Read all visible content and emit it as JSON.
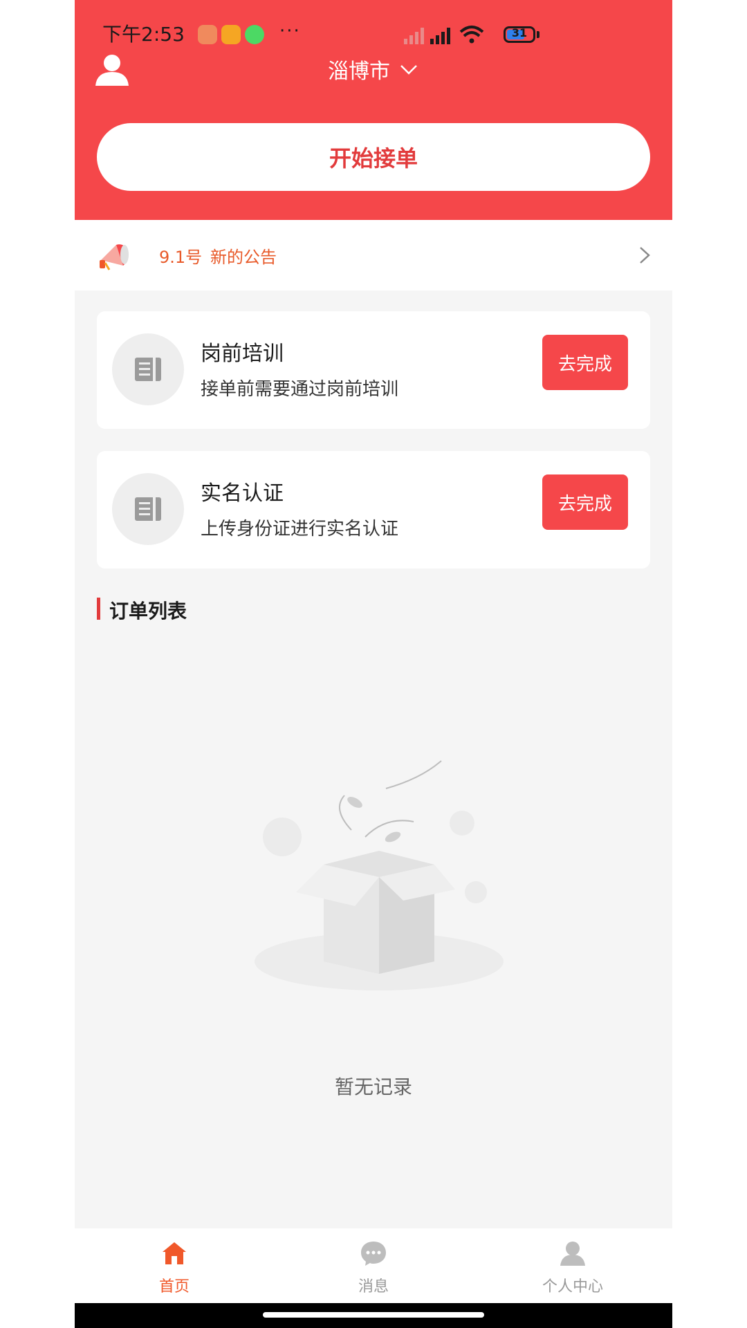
{
  "status_bar": {
    "time": "下午2:53",
    "battery": "31"
  },
  "header": {
    "city": "淄博市",
    "start_button": "开始接单"
  },
  "notice": {
    "date": "9.1号",
    "text": "新的公告"
  },
  "tasks": [
    {
      "title": "岗前培训",
      "desc": "接单前需要通过岗前培训",
      "button": "去完成"
    },
    {
      "title": "实名认证",
      "desc": "上传身份证进行实名认证",
      "button": "去完成"
    }
  ],
  "orders": {
    "title": "订单列表",
    "empty_text": "暂无记录"
  },
  "nav": {
    "items": [
      {
        "label": "首页",
        "icon": "home-icon",
        "active": true
      },
      {
        "label": "消息",
        "icon": "message-icon",
        "active": false
      },
      {
        "label": "个人中心",
        "icon": "user-icon",
        "active": false
      }
    ]
  },
  "colors": {
    "primary": "#f5474a",
    "accent_text": "#e85a2a",
    "nav_active": "#f0582a",
    "nav_inactive": "#999999"
  }
}
